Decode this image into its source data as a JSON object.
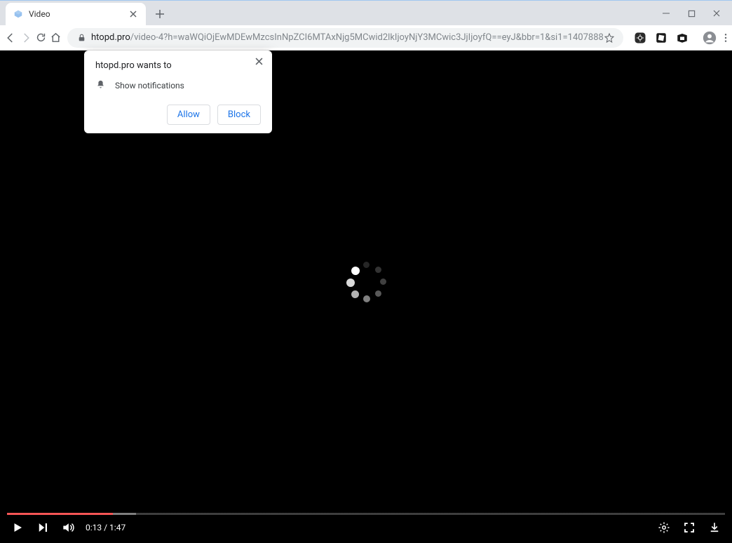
{
  "window": {
    "tab_title": "Video"
  },
  "address": {
    "domain": "htopd.pro",
    "path": "/video-4?h=waWQiOjEwMDEwMzcsInNpZCI6MTAxNjg5MCwid2lkIjoyNjY3MCwic3JjIjoyfQ==eyJ&bbr=1&si1=1407888"
  },
  "permission": {
    "title": "htopd.pro wants to",
    "show_notifications": "Show notifications",
    "allow": "Allow",
    "block": "Block"
  },
  "video": {
    "current_time": "0:13",
    "duration": "1:47",
    "time_display": "0:13 / 1:47"
  }
}
